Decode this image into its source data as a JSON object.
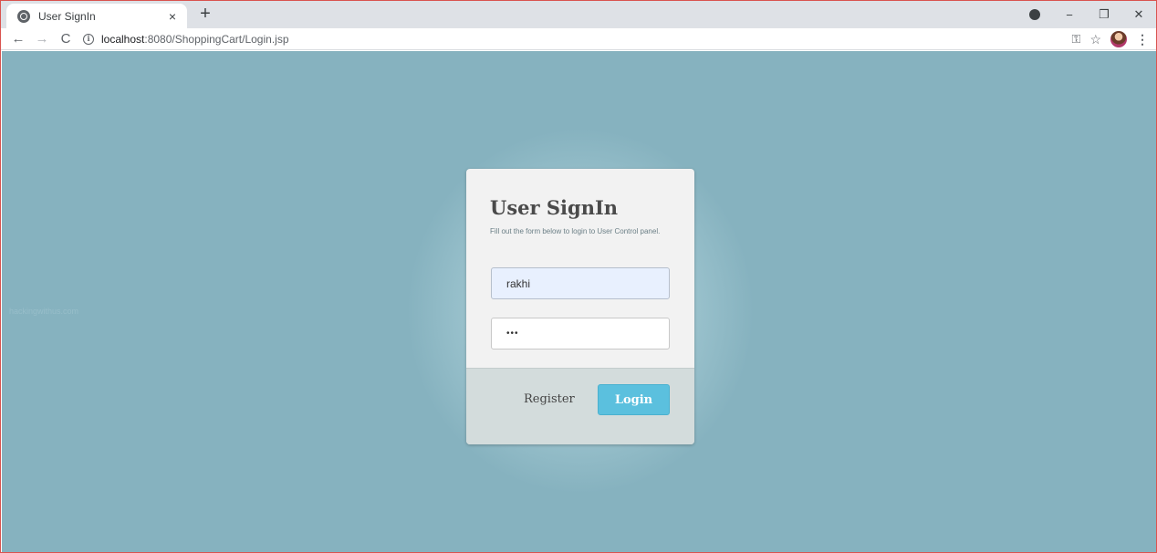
{
  "browser": {
    "tab": {
      "title": "User SignIn",
      "close": "×"
    },
    "new_tab": "+",
    "window": {
      "minimize": "−",
      "restore": "❐",
      "close": "✕"
    },
    "nav": {
      "back": "←",
      "forward": "→",
      "reload": "C"
    },
    "url": {
      "info": "i",
      "host": "localhost",
      "path": ":8080/ShoppingCart/Login.jsp"
    },
    "toolbar": {
      "key": "⚿",
      "star": "☆",
      "menu": "⋮"
    }
  },
  "page": {
    "background_color": "#86b2bf",
    "faint_text": "hackingwithus.com"
  },
  "login_card": {
    "title": "User SignIn",
    "subtitle": "Fill out the form below to login to User Control panel.",
    "username_value": "rakhi",
    "password_value": "•••",
    "register_label": "Register",
    "login_label": "Login",
    "login_color": "#5bc0de"
  }
}
